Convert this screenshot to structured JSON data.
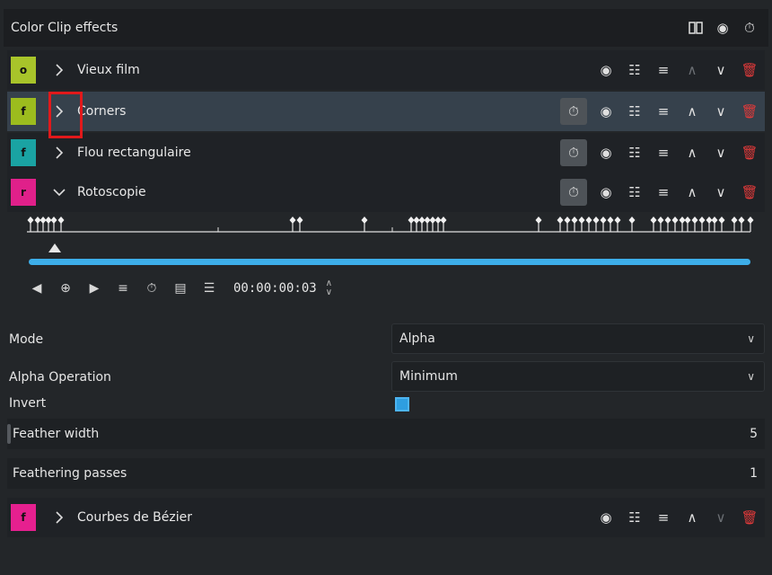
{
  "header": {
    "title": "Color Clip effects"
  },
  "effects": [
    {
      "badge": "o",
      "badge_color": "#a8c42a",
      "name": "Vieux film"
    },
    {
      "badge": "f",
      "badge_color": "#9cbc1e",
      "name": "Corners"
    },
    {
      "badge": "f",
      "badge_color": "#1aa3a3",
      "name": "Flou rectangulaire"
    },
    {
      "badge": "r",
      "badge_color": "#e0208a",
      "name": "Rotoscopie"
    },
    {
      "badge": "f",
      "badge_color": "#e6208f",
      "name": "Courbes de Bézier"
    }
  ],
  "timeline": {
    "timecode": "00:00:00:03",
    "progress_fraction": 1.0
  },
  "params": {
    "mode_label": "Mode",
    "mode_value": "Alpha",
    "alpha_op_label": "Alpha Operation",
    "alpha_op_value": "Minimum",
    "invert_label": "Invert",
    "invert_checked": true,
    "feather_width_label": "Feather width",
    "feather_width_value": "5",
    "feathering_passes_label": "Feathering passes",
    "feathering_passes_value": "1"
  },
  "colors": {
    "accent": "#3daee9",
    "danger": "#e03a3a",
    "highlight": "#e1191b"
  },
  "icons": [
    "compare-icon",
    "eye-icon",
    "keyframe-stopwatch-icon",
    "chevron-right-icon",
    "chevron-down-icon",
    "settings-sliders-icon",
    "menu-icon",
    "arrow-up-icon",
    "arrow-down-icon",
    "trash-icon"
  ]
}
